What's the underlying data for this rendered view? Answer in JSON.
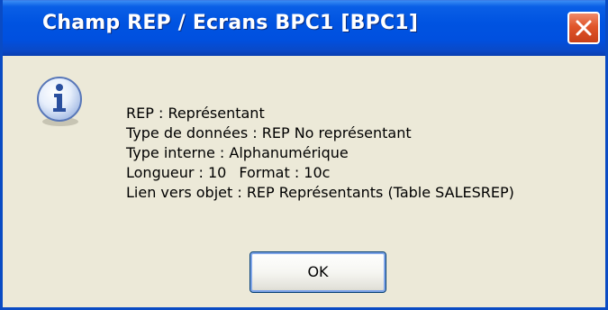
{
  "window": {
    "title": "Champ REP / Ecrans BPC1 [BPC1]"
  },
  "icons": {
    "info": "information-icon",
    "close": "close-icon"
  },
  "message": {
    "line1": "REP : Représentant",
    "line2": "Type de données : REP No représentant",
    "line3": "Type interne : Alphanumérique",
    "line4a": "Longueur : 10",
    "line4b": "Format : 10c",
    "line5": "Lien vers objet : REP Représentants (Table SALESREP)"
  },
  "buttons": {
    "ok_label": "OK"
  },
  "colors": {
    "titlebar": "#0053e1",
    "close": "#e0552a",
    "dialog_bg": "#ece9d8"
  }
}
